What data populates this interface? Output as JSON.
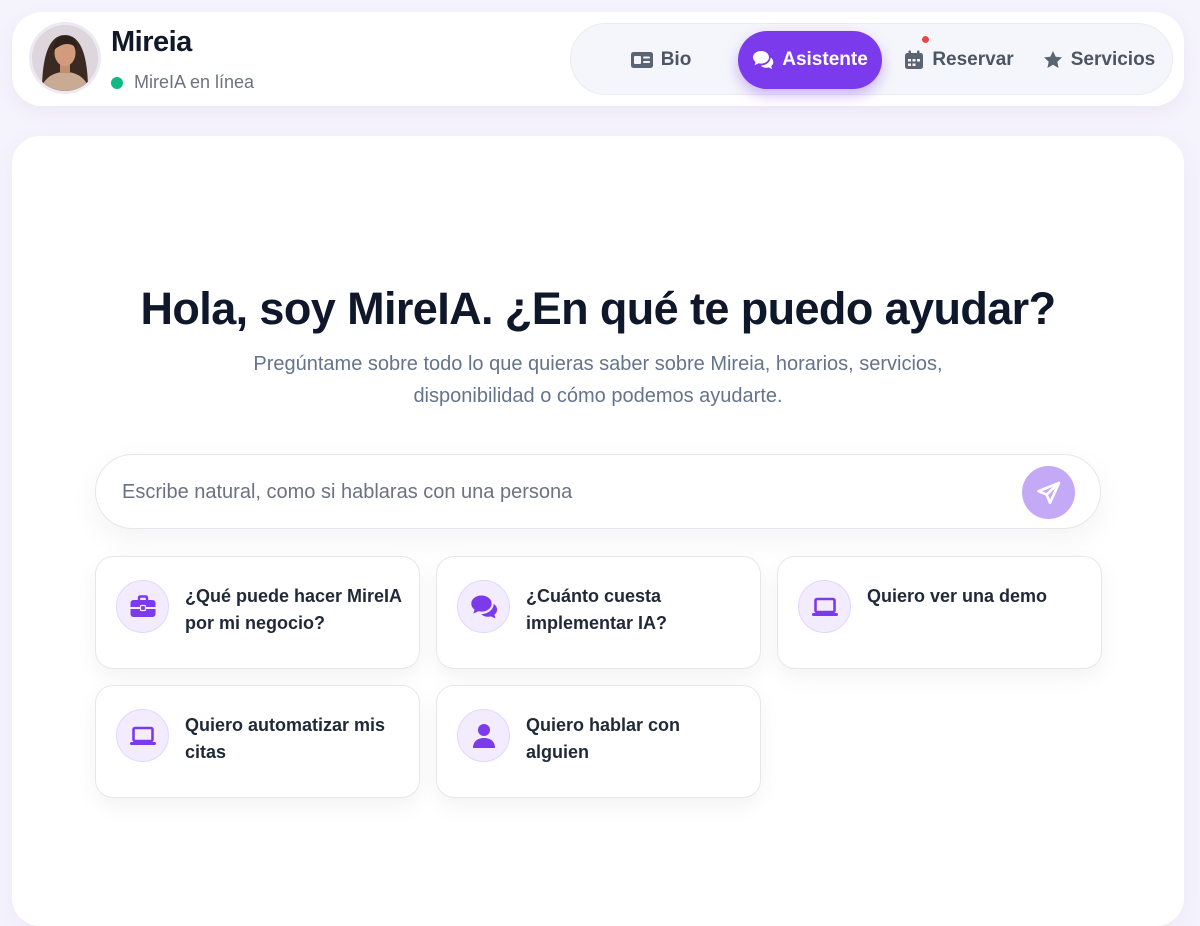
{
  "header": {
    "profile_name": "Mireia",
    "status_text": "MireIA en línea",
    "status_color": "#10b981"
  },
  "nav": {
    "items": [
      {
        "label": "Bio",
        "icon": "id-card-icon",
        "active": false
      },
      {
        "label": "Asistente",
        "icon": "chat-bubbles-icon",
        "active": true
      },
      {
        "label": "Reservar",
        "icon": "calendar-icon",
        "active": false,
        "notification": true
      },
      {
        "label": "Servicios",
        "icon": "star-icon",
        "active": false
      }
    ],
    "accent_color": "#7c3aed"
  },
  "main": {
    "title": "Hola, soy MireIA. ¿En qué te puedo ayudar?",
    "subtitle": "Pregúntame sobre todo lo que quieras saber sobre Mireia, horarios, servicios, disponibilidad o cómo podemos ayudarte.",
    "chat": {
      "placeholder": "Escribe natural, como si hablaras con una persona",
      "value": "",
      "send_icon": "paper-plane-icon"
    },
    "suggestions": [
      {
        "label": "¿Qué puede hacer MireIA por mi negocio?",
        "icon": "briefcase-icon"
      },
      {
        "label": "¿Cuánto cuesta implementar IA?",
        "icon": "chat-bubbles-icon"
      },
      {
        "label": "Quiero ver una demo",
        "icon": "laptop-icon"
      },
      {
        "label": "Quiero automatizar mis citas",
        "icon": "laptop-icon"
      },
      {
        "label": "Quiero hablar con alguien",
        "icon": "user-icon"
      }
    ]
  }
}
